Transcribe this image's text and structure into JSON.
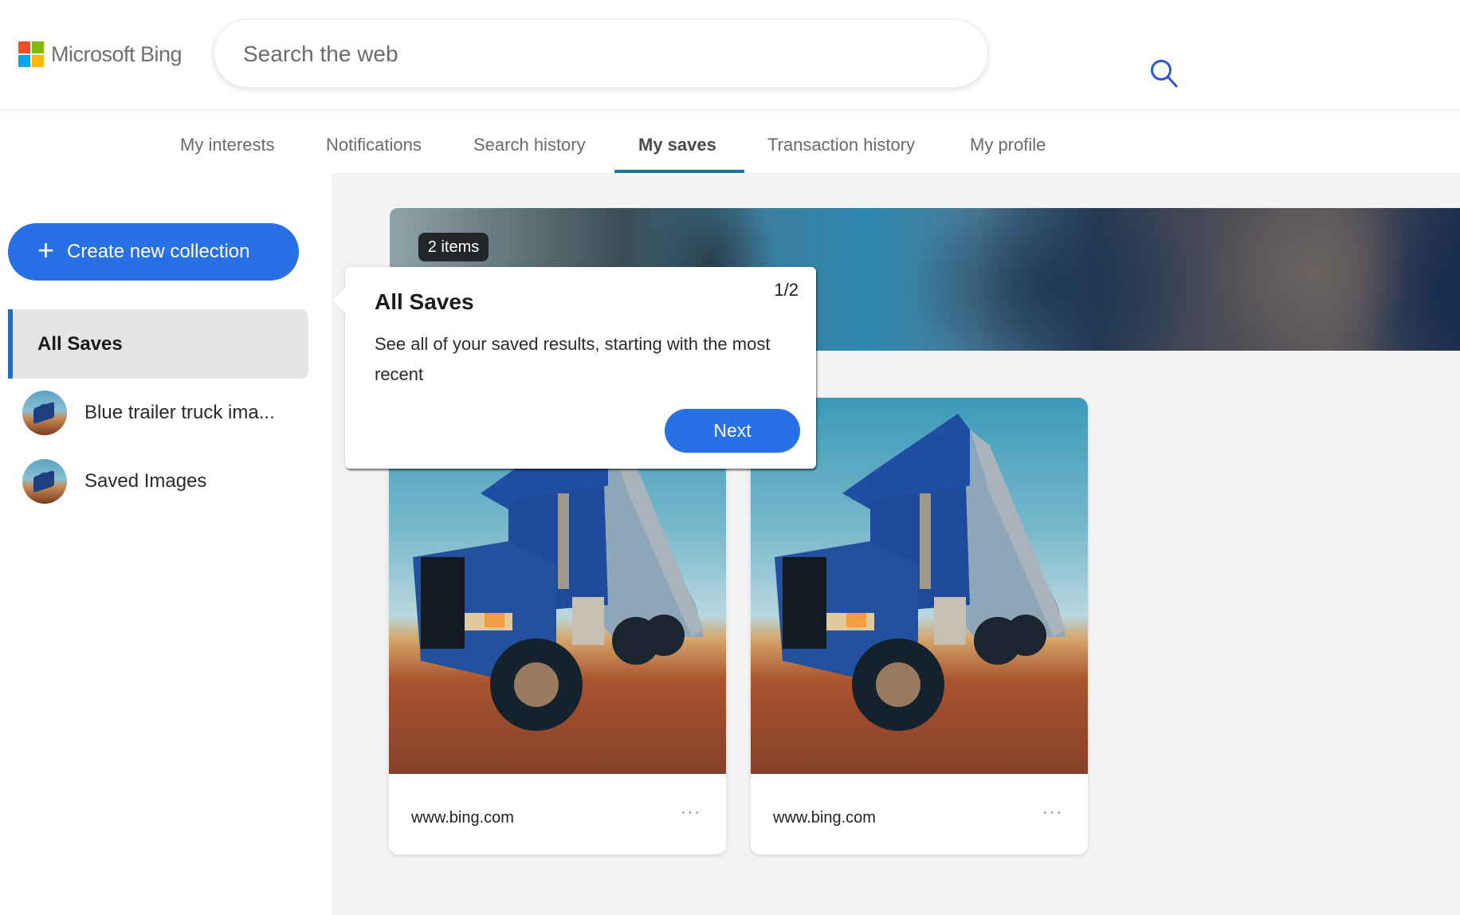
{
  "header": {
    "brand": "Microsoft Bing",
    "logo_colors": [
      "#f25022",
      "#7fba00",
      "#00a4ef",
      "#ffb900"
    ],
    "search": {
      "placeholder": "Search the web",
      "value": ""
    }
  },
  "nav": {
    "tabs": [
      {
        "label": "My interests",
        "active": false
      },
      {
        "label": "Notifications",
        "active": false
      },
      {
        "label": "Search history",
        "active": false
      },
      {
        "label": "My saves",
        "active": true
      },
      {
        "label": "Transaction history",
        "active": false
      },
      {
        "label": "My profile",
        "active": false
      }
    ],
    "accent_color": "#1a7896"
  },
  "sidebar": {
    "create_button": {
      "icon": "plus-icon",
      "label": "Create new collection"
    },
    "items": [
      {
        "label": "All Saves",
        "active": true
      },
      {
        "label": "Blue trailer truck ima...",
        "thumbnail": "blue-truck-thumbnail"
      },
      {
        "label": "Saved Images",
        "thumbnail": "blue-truck-thumbnail"
      }
    ]
  },
  "main": {
    "banner": {
      "item_count": "2 items"
    },
    "cards": [
      {
        "image": "blue-trailer-truck-image",
        "domain": "www.bing.com",
        "more": "···"
      },
      {
        "image": "blue-trailer-truck-image",
        "domain": "www.bing.com",
        "more": "···"
      }
    ]
  },
  "tooltip": {
    "title": "All Saves",
    "step": "1/2",
    "body": "See all of your saved results, starting with the most recent",
    "next_label": "Next"
  },
  "colors": {
    "primary_button": "#2970e4",
    "search_icon": "#2b56d6",
    "active_item_border": "#1f6fc5"
  }
}
